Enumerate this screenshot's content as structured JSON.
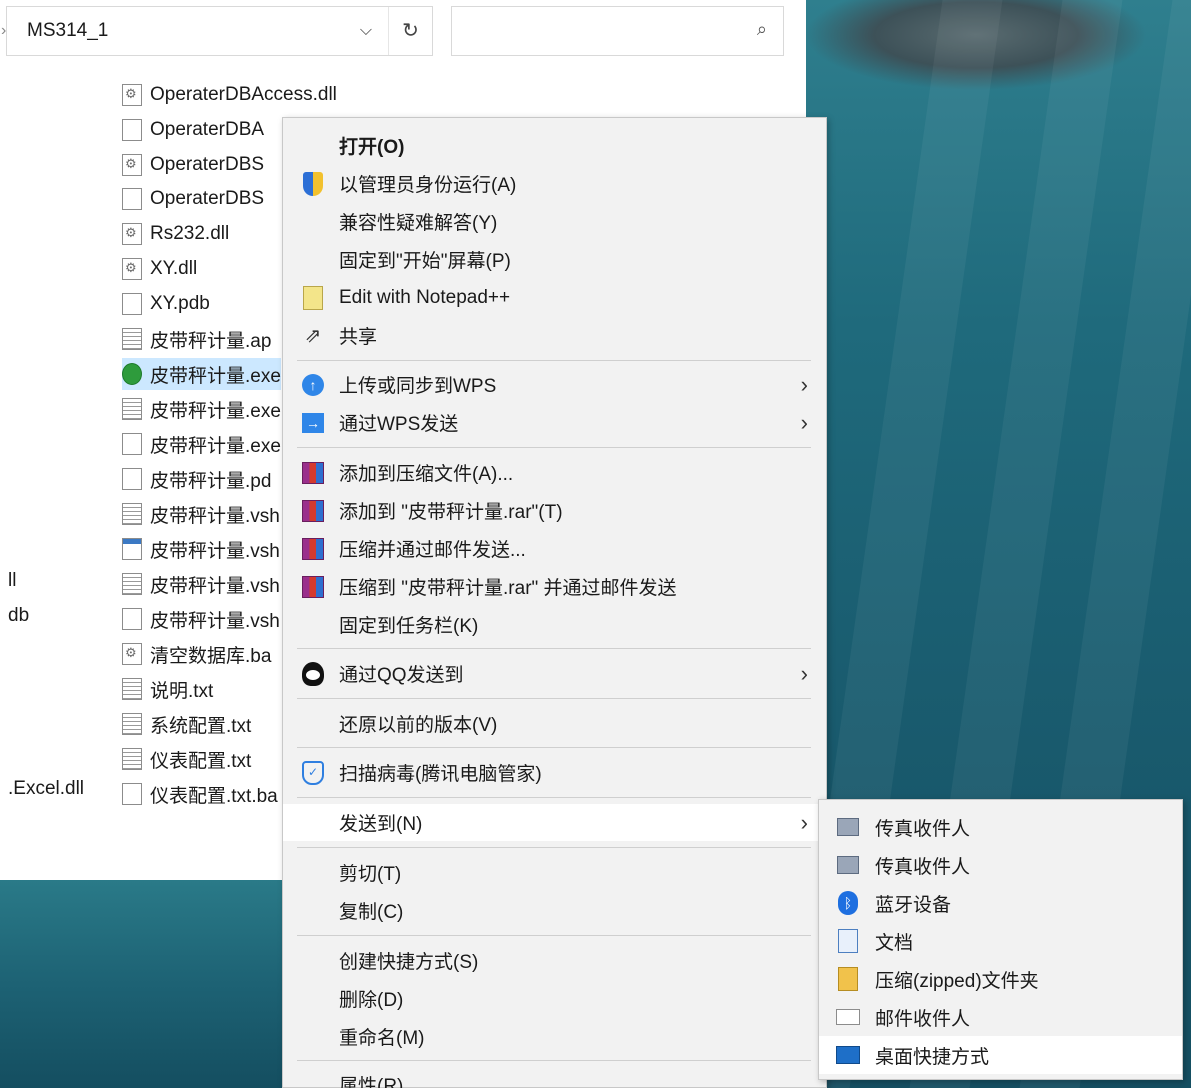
{
  "explorer": {
    "path": "MS314_1",
    "files": [
      {
        "name": "OperaterDBAccess.dll",
        "icon": "gear"
      },
      {
        "name": "OperaterDBA",
        "icon": "blank"
      },
      {
        "name": "OperaterDBS",
        "icon": "gear"
      },
      {
        "name": "OperaterDBS",
        "icon": "blank"
      },
      {
        "name": "Rs232.dll",
        "icon": "gear"
      },
      {
        "name": "XY.dll",
        "icon": "gear"
      },
      {
        "name": "XY.pdb",
        "icon": "blank"
      },
      {
        "name": "皮带秤计量.ap",
        "icon": "lines"
      },
      {
        "name": "皮带秤计量.exe",
        "icon": "app"
      },
      {
        "name": "皮带秤计量.exe",
        "icon": "lines"
      },
      {
        "name": "皮带秤计量.exe",
        "icon": "blank"
      },
      {
        "name": "皮带秤计量.pd",
        "icon": "blank"
      },
      {
        "name": "皮带秤计量.vsh",
        "icon": "lines"
      },
      {
        "name": "皮带秤计量.vsh",
        "icon": "win"
      },
      {
        "name": "皮带秤计量.vsh",
        "icon": "lines"
      },
      {
        "name": "皮带秤计量.vsh",
        "icon": "blank"
      },
      {
        "name": "清空数据库.ba",
        "icon": "gear"
      },
      {
        "name": "说明.txt",
        "icon": "lines"
      },
      {
        "name": "系统配置.txt",
        "icon": "lines"
      },
      {
        "name": "仪表配置.txt",
        "icon": "lines"
      },
      {
        "name": "仪表配置.txt.ba",
        "icon": "blank"
      }
    ],
    "left_column": [
      "ll",
      "db",
      ".Excel.dll"
    ]
  },
  "context_menu": {
    "open": "打开(O)",
    "run_as_admin": "以管理员身份运行(A)",
    "troubleshoot": "兼容性疑难解答(Y)",
    "pin_start": "固定到\"开始\"屏幕(P)",
    "notepad": "Edit with Notepad++",
    "share": "共享",
    "wps_upload": "上传或同步到WPS",
    "wps_send": "通过WPS发送",
    "add_archive": "添加到压缩文件(A)...",
    "add_rar": "添加到 \"皮带秤计量.rar\"(T)",
    "compress_mail": "压缩并通过邮件发送...",
    "compress_rar_mail": "压缩到 \"皮带秤计量.rar\" 并通过邮件发送",
    "pin_taskbar": "固定到任务栏(K)",
    "qq_send": "通过QQ发送到",
    "restore_versions": "还原以前的版本(V)",
    "virus_scan": "扫描病毒(腾讯电脑管家)",
    "send_to": "发送到(N)",
    "cut": "剪切(T)",
    "copy": "复制(C)",
    "create_shortcut": "创建快捷方式(S)",
    "delete": "删除(D)",
    "rename": "重命名(M)",
    "properties": "属性(R)"
  },
  "send_to_menu": {
    "fax1": "传真收件人",
    "fax2": "传真收件人",
    "bluetooth": "蓝牙设备",
    "documents": "文档",
    "zip": "压缩(zipped)文件夹",
    "mail": "邮件收件人",
    "desktop": "桌面快捷方式"
  }
}
